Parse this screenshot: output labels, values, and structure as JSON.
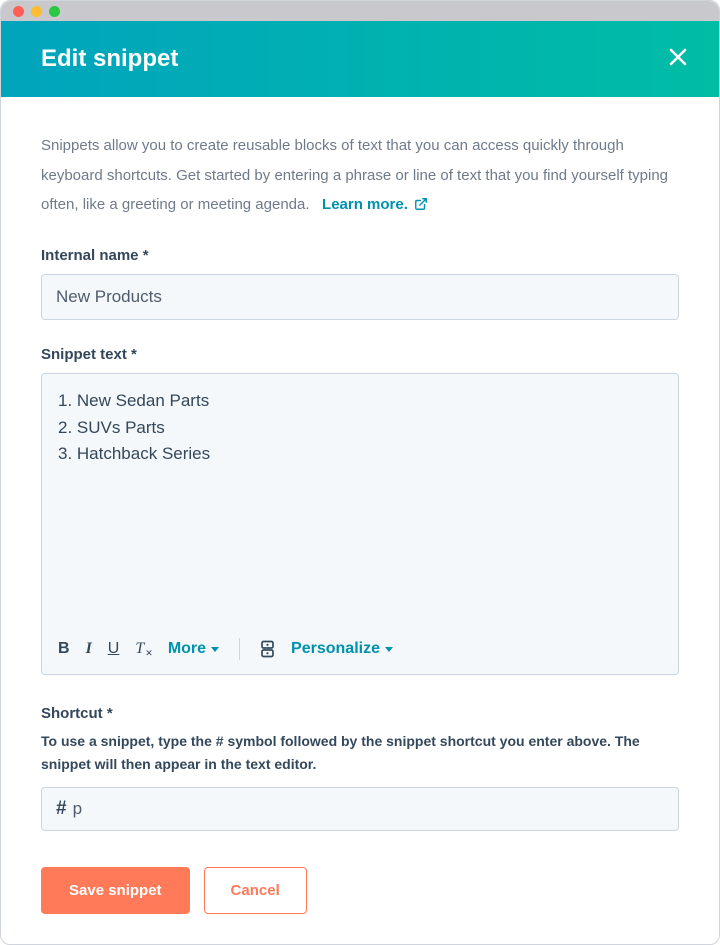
{
  "header": {
    "title": "Edit snippet"
  },
  "intro": {
    "text": "Snippets allow you to create reusable blocks of text that you can access quickly through keyboard shortcuts. Get started by entering a phrase or line of text that you find yourself typing often, like a greeting or meeting agenda.",
    "learn_more": "Learn more."
  },
  "fields": {
    "name_label": "Internal name *",
    "name_value": "New Products",
    "text_label": "Snippet text *",
    "text_lines": [
      "1. New Sedan Parts",
      "2. SUVs Parts",
      "3. Hatchback Series"
    ],
    "shortcut_label": "Shortcut *",
    "shortcut_help": "To use a snippet, type the # symbol followed by the snippet shortcut you enter above. The snippet will then appear in the text editor.",
    "shortcut_prefix": "#",
    "shortcut_value": "p"
  },
  "toolbar": {
    "bold": "B",
    "italic": "I",
    "underline": "U",
    "clear": "T",
    "clear_sub": "✕",
    "more": "More",
    "personalize": "Personalize"
  },
  "footer": {
    "save": "Save snippet",
    "cancel": "Cancel"
  }
}
